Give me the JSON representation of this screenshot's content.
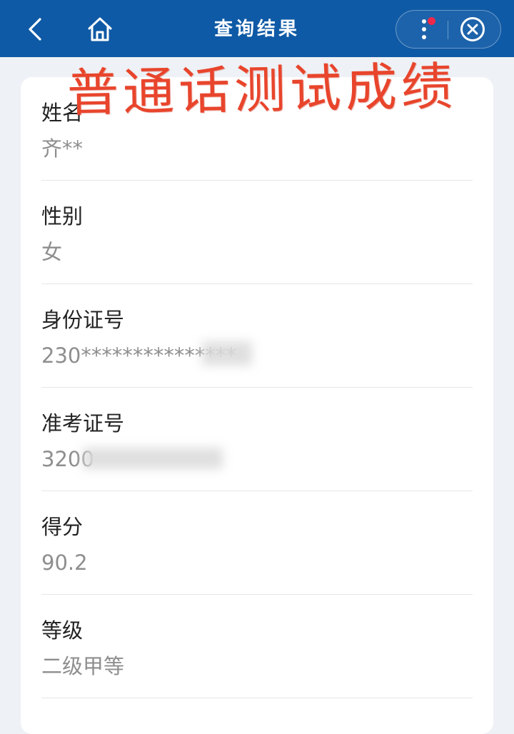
{
  "header": {
    "title": "查询结果",
    "back_icon": "chevron-left-icon",
    "home_icon": "home-icon",
    "more_icon": "more-vertical-icon",
    "close_icon": "close-circle-icon",
    "background_color": "#0f5aa6",
    "badge_color": "#f0284a"
  },
  "annotation": {
    "text": "普通话测试成绩",
    "color": "#e8452c"
  },
  "result": {
    "fields": [
      {
        "label": "姓名",
        "value": "齐**"
      },
      {
        "label": "性别",
        "value": "女"
      },
      {
        "label": "身份证号",
        "value": "230***************"
      },
      {
        "label": "准考证号",
        "value": "3200"
      },
      {
        "label": "得分",
        "value": "90.2"
      },
      {
        "label": "等级",
        "value": "二级甲等"
      }
    ]
  }
}
